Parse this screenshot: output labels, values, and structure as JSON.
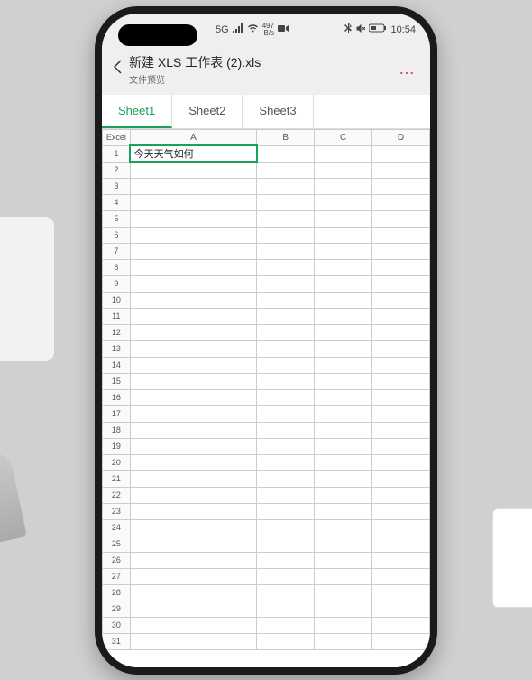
{
  "status": {
    "network_badge": "5G",
    "speed_top": "497",
    "speed_bot": "B/s",
    "time": "10:54"
  },
  "header": {
    "title": "新建 XLS 工作表 (2).xls",
    "subtitle": "文件预览",
    "more_label": "…"
  },
  "tabs": [
    {
      "label": "Sheet1",
      "active": true
    },
    {
      "label": "Sheet2",
      "active": false
    },
    {
      "label": "Sheet3",
      "active": false
    }
  ],
  "sheet": {
    "corner_label": "Excel",
    "columns": [
      "A",
      "B",
      "C",
      "D"
    ],
    "row_count": 31,
    "cells": {
      "A1": "今天天气如何"
    },
    "selected": "A1"
  }
}
